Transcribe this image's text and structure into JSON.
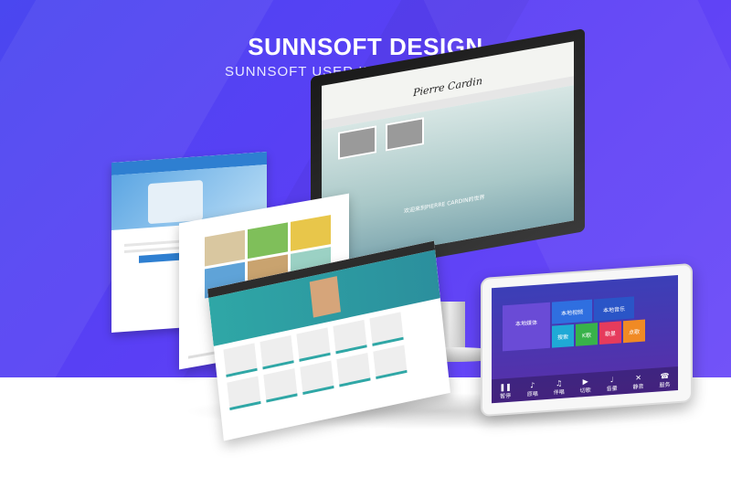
{
  "hero": {
    "title": "SUNNSOFT DESIGN",
    "subtitle": "SUNNSOFT USER INTERFACE DESIGN"
  },
  "monitor": {
    "logo": "Pierre Cardin",
    "caption": "欢迎来到PIERRE CARDIN的世界"
  },
  "tablet": {
    "tiles": [
      "本地媒体",
      "本地视频",
      "本地音乐",
      "搜索",
      "K歌",
      "歌星",
      "点歌"
    ],
    "controls": [
      "暂停",
      "原唱",
      "伴唱",
      "切歌",
      "音量",
      "静音",
      "服务"
    ]
  },
  "colors": {
    "background": "#4a47f0",
    "teal": "#2fa7a6",
    "blue": "#2e7fd1",
    "tablet_screen": "#3b3fb7"
  }
}
